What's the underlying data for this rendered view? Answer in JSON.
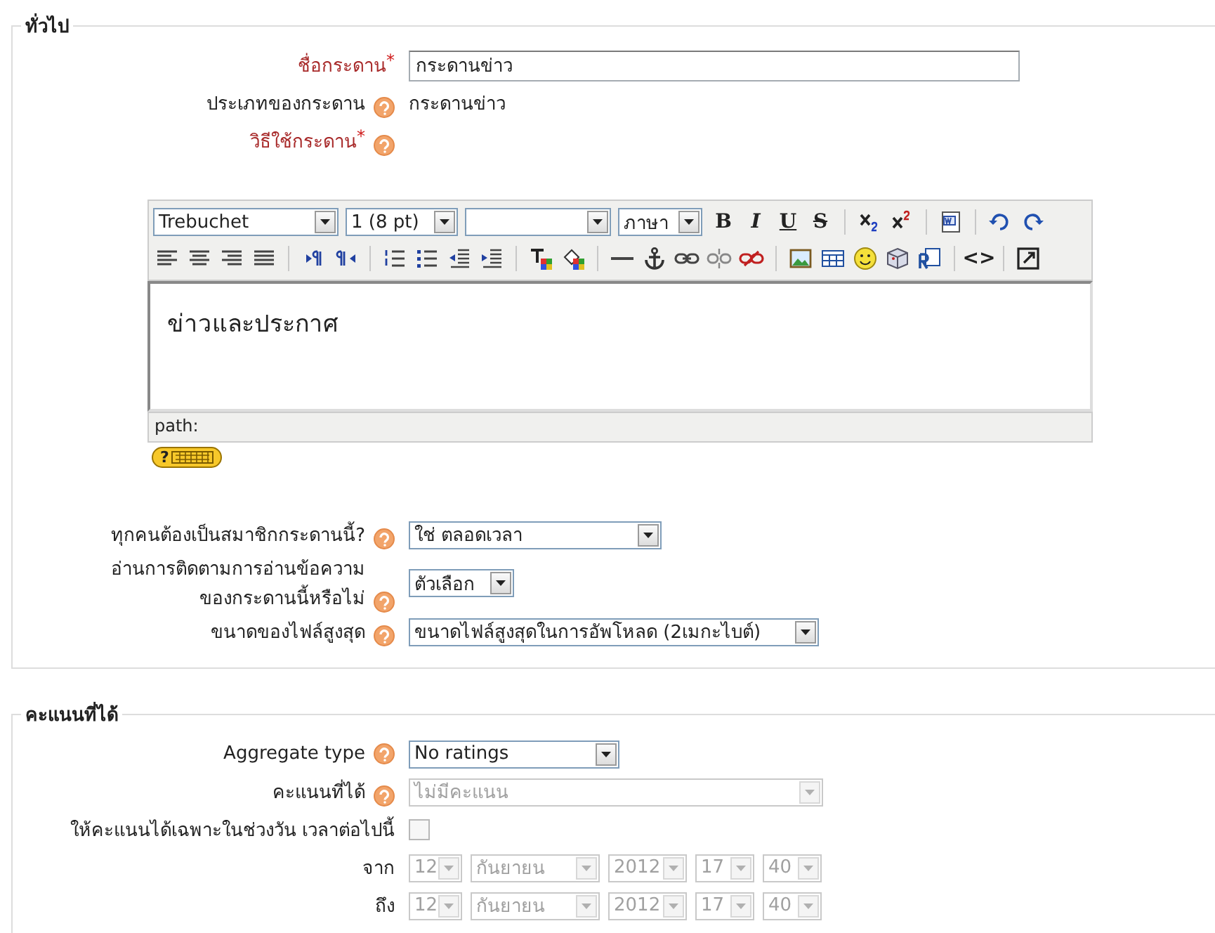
{
  "sections": [
    {
      "legend": "ทั่วไป",
      "rows": [
        {
          "kind": "text-input",
          "label": "ชื่อกระดาน",
          "required": true,
          "required_mark": "*",
          "help": false,
          "value": "กระดานข่าว"
        },
        {
          "kind": "static",
          "label": "ประเภทของกระดาน",
          "required": false,
          "help": true,
          "value": "กระดานข่าว"
        },
        {
          "kind": "label-only",
          "label": "วิธีใช้กระดาน",
          "required": true,
          "required_mark": "*",
          "help": true
        },
        {
          "kind": "editor",
          "content": "ข่าวและประกาศ",
          "path_label": "path:",
          "help_label": "?",
          "toolbar": [
            [
              {
                "kind": "select",
                "value": "Trebuchet"
              },
              {
                "kind": "select",
                "value": "1 (8 pt)"
              },
              {
                "kind": "select"
              },
              {
                "kind": "select",
                "value": "ภาษา"
              },
              {
                "kind": "bold",
                "label": "B"
              },
              {
                "kind": "italic",
                "label": "I"
              },
              {
                "kind": "underline",
                "label": "U"
              },
              {
                "kind": "strike",
                "label": "S"
              },
              {
                "kind": "separator"
              },
              {
                "kind": "subscript"
              },
              {
                "kind": "superscript"
              },
              {
                "kind": "separator"
              },
              {
                "kind": "word"
              },
              {
                "kind": "separator"
              },
              {
                "kind": "undo"
              },
              {
                "kind": "redo"
              }
            ],
            [
              {
                "kind": "align-left"
              },
              {
                "kind": "align-center"
              },
              {
                "kind": "align-right"
              },
              {
                "kind": "justify"
              },
              {
                "kind": "separator"
              },
              {
                "kind": "ltr"
              },
              {
                "kind": "rtl"
              },
              {
                "kind": "separator"
              },
              {
                "kind": "ordered-list"
              },
              {
                "kind": "bullet-list"
              },
              {
                "kind": "outdent"
              },
              {
                "kind": "indent"
              },
              {
                "kind": "separator"
              },
              {
                "kind": "text-color"
              },
              {
                "kind": "background-color"
              },
              {
                "kind": "separator"
              },
              {
                "kind": "rule"
              },
              {
                "kind": "anchor"
              },
              {
                "kind": "link"
              },
              {
                "kind": "unlink"
              },
              {
                "kind": "nolink"
              },
              {
                "kind": "separator"
              },
              {
                "kind": "image"
              },
              {
                "kind": "table"
              },
              {
                "kind": "smiley"
              },
              {
                "kind": "special-char"
              },
              {
                "kind": "search-replace"
              },
              {
                "kind": "separator"
              },
              {
                "kind": "html",
                "label": "<>"
              },
              {
                "kind": "separator"
              },
              {
                "kind": "fullscreen"
              }
            ]
          ]
        },
        {
          "kind": "select",
          "label": "ทุกคนต้องเป็นสมาชิกกระดานนี้?",
          "required": false,
          "help": true,
          "value": "ใช่ ตลอดเวลา",
          "disabled": false
        },
        {
          "kind": "select",
          "label": "อ่านการติดตามการอ่านข้อความ\nของกระดานนี้หรือไม่",
          "required": false,
          "help": true,
          "value": "ตัวเลือก",
          "disabled": false
        },
        {
          "kind": "select",
          "label": "ขนาดของไฟล์สูงสุด",
          "required": false,
          "help": true,
          "value": "ขนาดไฟล์สูงสุดในการอัพโหลด (2เมกะไบต์)",
          "disabled": false
        }
      ]
    },
    {
      "legend": "คะแนนที่ได้",
      "rows": [
        {
          "kind": "select",
          "label": "Aggregate type",
          "required": false,
          "help": true,
          "value": "No ratings",
          "disabled": false
        },
        {
          "kind": "select",
          "label": "คะแนนที่ได้",
          "required": false,
          "help": true,
          "value": "ไม่มีคะแนน",
          "disabled": true
        },
        {
          "kind": "checkbox",
          "label": "ให้คะแนนได้เฉพาะในช่วงวัน เวลาต่อไปนี้",
          "required": false,
          "help": false,
          "checked": false
        },
        {
          "kind": "date",
          "label": "จาก",
          "required": false,
          "help": false,
          "fields": [
            {
              "value": "12",
              "disabled": true
            },
            {
              "value": "กันยายน",
              "disabled": true
            },
            {
              "value": "2012",
              "disabled": true
            },
            {
              "value": "17",
              "disabled": true
            },
            {
              "value": "40",
              "disabled": true
            }
          ]
        },
        {
          "kind": "date",
          "label": "ถึง",
          "required": false,
          "help": false,
          "fields": [
            {
              "value": "12",
              "disabled": true
            },
            {
              "value": "กันยายน",
              "disabled": true
            },
            {
              "value": "2012",
              "disabled": true
            },
            {
              "value": "17",
              "disabled": true
            },
            {
              "value": "40",
              "disabled": true
            }
          ]
        }
      ]
    }
  ]
}
